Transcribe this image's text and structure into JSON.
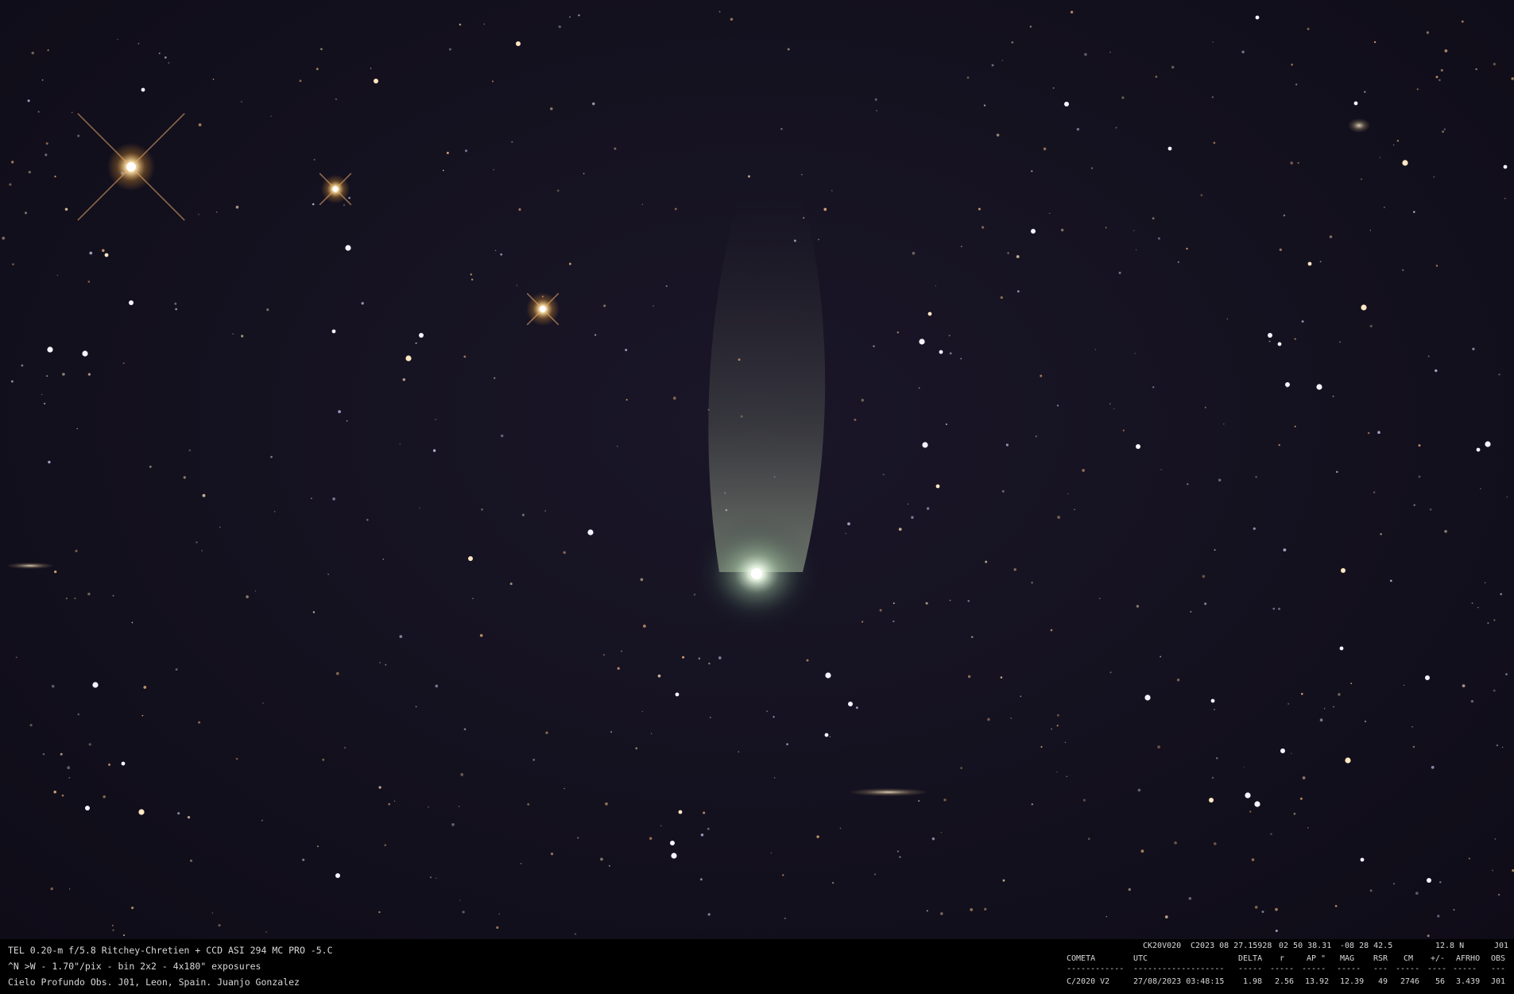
{
  "caption": {
    "lines": [
      "TEL 0.20-m f/5.8 Ritchey-Chretien + CCD ASI 294 MC PRO -5.C",
      "^N >W - 1.70\"/pix - bin 2x2 - 4x180\" exposures",
      "Cielo Profundo Obs. J01, Leon, Spain. Juanjo Gonzalez"
    ]
  },
  "ephemeris": {
    "header_line": {
      "designation": "CK20V020",
      "date": "C2023 08 27.15928",
      "ra": "02 50 38.31",
      "dec": "-08 28 42.5",
      "mag": "12.8 N",
      "obs": "J01"
    },
    "columns": [
      "COMETA",
      "UTC",
      "DELTA",
      "r",
      "AP \"",
      "MAG",
      "RSR",
      "CM",
      "+/-",
      "AFRHO",
      "OBS"
    ],
    "separators": [
      "------------",
      "-------------------",
      "-----",
      "-----",
      "-----",
      "-----",
      "---",
      "-----",
      "----",
      "-----",
      "---"
    ],
    "row": [
      "C/2020 V2",
      "27/08/2023 03:48:15",
      "1.98",
      "2.56",
      "13.92",
      "12.39",
      "49",
      "2746",
      "56",
      "3.439",
      "J01"
    ]
  },
  "colors": {
    "sky": "#14111f",
    "coma": "#cfe8c8",
    "tail": "#a9b89a",
    "caption_text": "#d8d8d8"
  }
}
